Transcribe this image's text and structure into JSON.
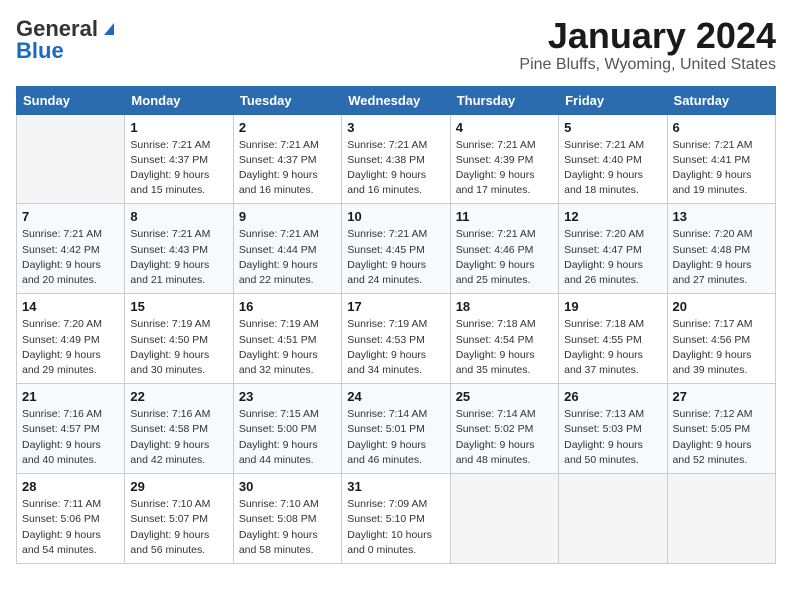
{
  "header": {
    "logo_general": "General",
    "logo_blue": "Blue",
    "month_title": "January 2024",
    "location": "Pine Bluffs, Wyoming, United States"
  },
  "calendar": {
    "days_of_week": [
      "Sunday",
      "Monday",
      "Tuesday",
      "Wednesday",
      "Thursday",
      "Friday",
      "Saturday"
    ],
    "weeks": [
      [
        {
          "day": "",
          "info": ""
        },
        {
          "day": "1",
          "info": "Sunrise: 7:21 AM\nSunset: 4:37 PM\nDaylight: 9 hours\nand 15 minutes."
        },
        {
          "day": "2",
          "info": "Sunrise: 7:21 AM\nSunset: 4:37 PM\nDaylight: 9 hours\nand 16 minutes."
        },
        {
          "day": "3",
          "info": "Sunrise: 7:21 AM\nSunset: 4:38 PM\nDaylight: 9 hours\nand 16 minutes."
        },
        {
          "day": "4",
          "info": "Sunrise: 7:21 AM\nSunset: 4:39 PM\nDaylight: 9 hours\nand 17 minutes."
        },
        {
          "day": "5",
          "info": "Sunrise: 7:21 AM\nSunset: 4:40 PM\nDaylight: 9 hours\nand 18 minutes."
        },
        {
          "day": "6",
          "info": "Sunrise: 7:21 AM\nSunset: 4:41 PM\nDaylight: 9 hours\nand 19 minutes."
        }
      ],
      [
        {
          "day": "7",
          "info": "Sunrise: 7:21 AM\nSunset: 4:42 PM\nDaylight: 9 hours\nand 20 minutes."
        },
        {
          "day": "8",
          "info": "Sunrise: 7:21 AM\nSunset: 4:43 PM\nDaylight: 9 hours\nand 21 minutes."
        },
        {
          "day": "9",
          "info": "Sunrise: 7:21 AM\nSunset: 4:44 PM\nDaylight: 9 hours\nand 22 minutes."
        },
        {
          "day": "10",
          "info": "Sunrise: 7:21 AM\nSunset: 4:45 PM\nDaylight: 9 hours\nand 24 minutes."
        },
        {
          "day": "11",
          "info": "Sunrise: 7:21 AM\nSunset: 4:46 PM\nDaylight: 9 hours\nand 25 minutes."
        },
        {
          "day": "12",
          "info": "Sunrise: 7:20 AM\nSunset: 4:47 PM\nDaylight: 9 hours\nand 26 minutes."
        },
        {
          "day": "13",
          "info": "Sunrise: 7:20 AM\nSunset: 4:48 PM\nDaylight: 9 hours\nand 27 minutes."
        }
      ],
      [
        {
          "day": "14",
          "info": "Sunrise: 7:20 AM\nSunset: 4:49 PM\nDaylight: 9 hours\nand 29 minutes."
        },
        {
          "day": "15",
          "info": "Sunrise: 7:19 AM\nSunset: 4:50 PM\nDaylight: 9 hours\nand 30 minutes."
        },
        {
          "day": "16",
          "info": "Sunrise: 7:19 AM\nSunset: 4:51 PM\nDaylight: 9 hours\nand 32 minutes."
        },
        {
          "day": "17",
          "info": "Sunrise: 7:19 AM\nSunset: 4:53 PM\nDaylight: 9 hours\nand 34 minutes."
        },
        {
          "day": "18",
          "info": "Sunrise: 7:18 AM\nSunset: 4:54 PM\nDaylight: 9 hours\nand 35 minutes."
        },
        {
          "day": "19",
          "info": "Sunrise: 7:18 AM\nSunset: 4:55 PM\nDaylight: 9 hours\nand 37 minutes."
        },
        {
          "day": "20",
          "info": "Sunrise: 7:17 AM\nSunset: 4:56 PM\nDaylight: 9 hours\nand 39 minutes."
        }
      ],
      [
        {
          "day": "21",
          "info": "Sunrise: 7:16 AM\nSunset: 4:57 PM\nDaylight: 9 hours\nand 40 minutes."
        },
        {
          "day": "22",
          "info": "Sunrise: 7:16 AM\nSunset: 4:58 PM\nDaylight: 9 hours\nand 42 minutes."
        },
        {
          "day": "23",
          "info": "Sunrise: 7:15 AM\nSunset: 5:00 PM\nDaylight: 9 hours\nand 44 minutes."
        },
        {
          "day": "24",
          "info": "Sunrise: 7:14 AM\nSunset: 5:01 PM\nDaylight: 9 hours\nand 46 minutes."
        },
        {
          "day": "25",
          "info": "Sunrise: 7:14 AM\nSunset: 5:02 PM\nDaylight: 9 hours\nand 48 minutes."
        },
        {
          "day": "26",
          "info": "Sunrise: 7:13 AM\nSunset: 5:03 PM\nDaylight: 9 hours\nand 50 minutes."
        },
        {
          "day": "27",
          "info": "Sunrise: 7:12 AM\nSunset: 5:05 PM\nDaylight: 9 hours\nand 52 minutes."
        }
      ],
      [
        {
          "day": "28",
          "info": "Sunrise: 7:11 AM\nSunset: 5:06 PM\nDaylight: 9 hours\nand 54 minutes."
        },
        {
          "day": "29",
          "info": "Sunrise: 7:10 AM\nSunset: 5:07 PM\nDaylight: 9 hours\nand 56 minutes."
        },
        {
          "day": "30",
          "info": "Sunrise: 7:10 AM\nSunset: 5:08 PM\nDaylight: 9 hours\nand 58 minutes."
        },
        {
          "day": "31",
          "info": "Sunrise: 7:09 AM\nSunset: 5:10 PM\nDaylight: 10 hours\nand 0 minutes."
        },
        {
          "day": "",
          "info": ""
        },
        {
          "day": "",
          "info": ""
        },
        {
          "day": "",
          "info": ""
        }
      ]
    ]
  }
}
